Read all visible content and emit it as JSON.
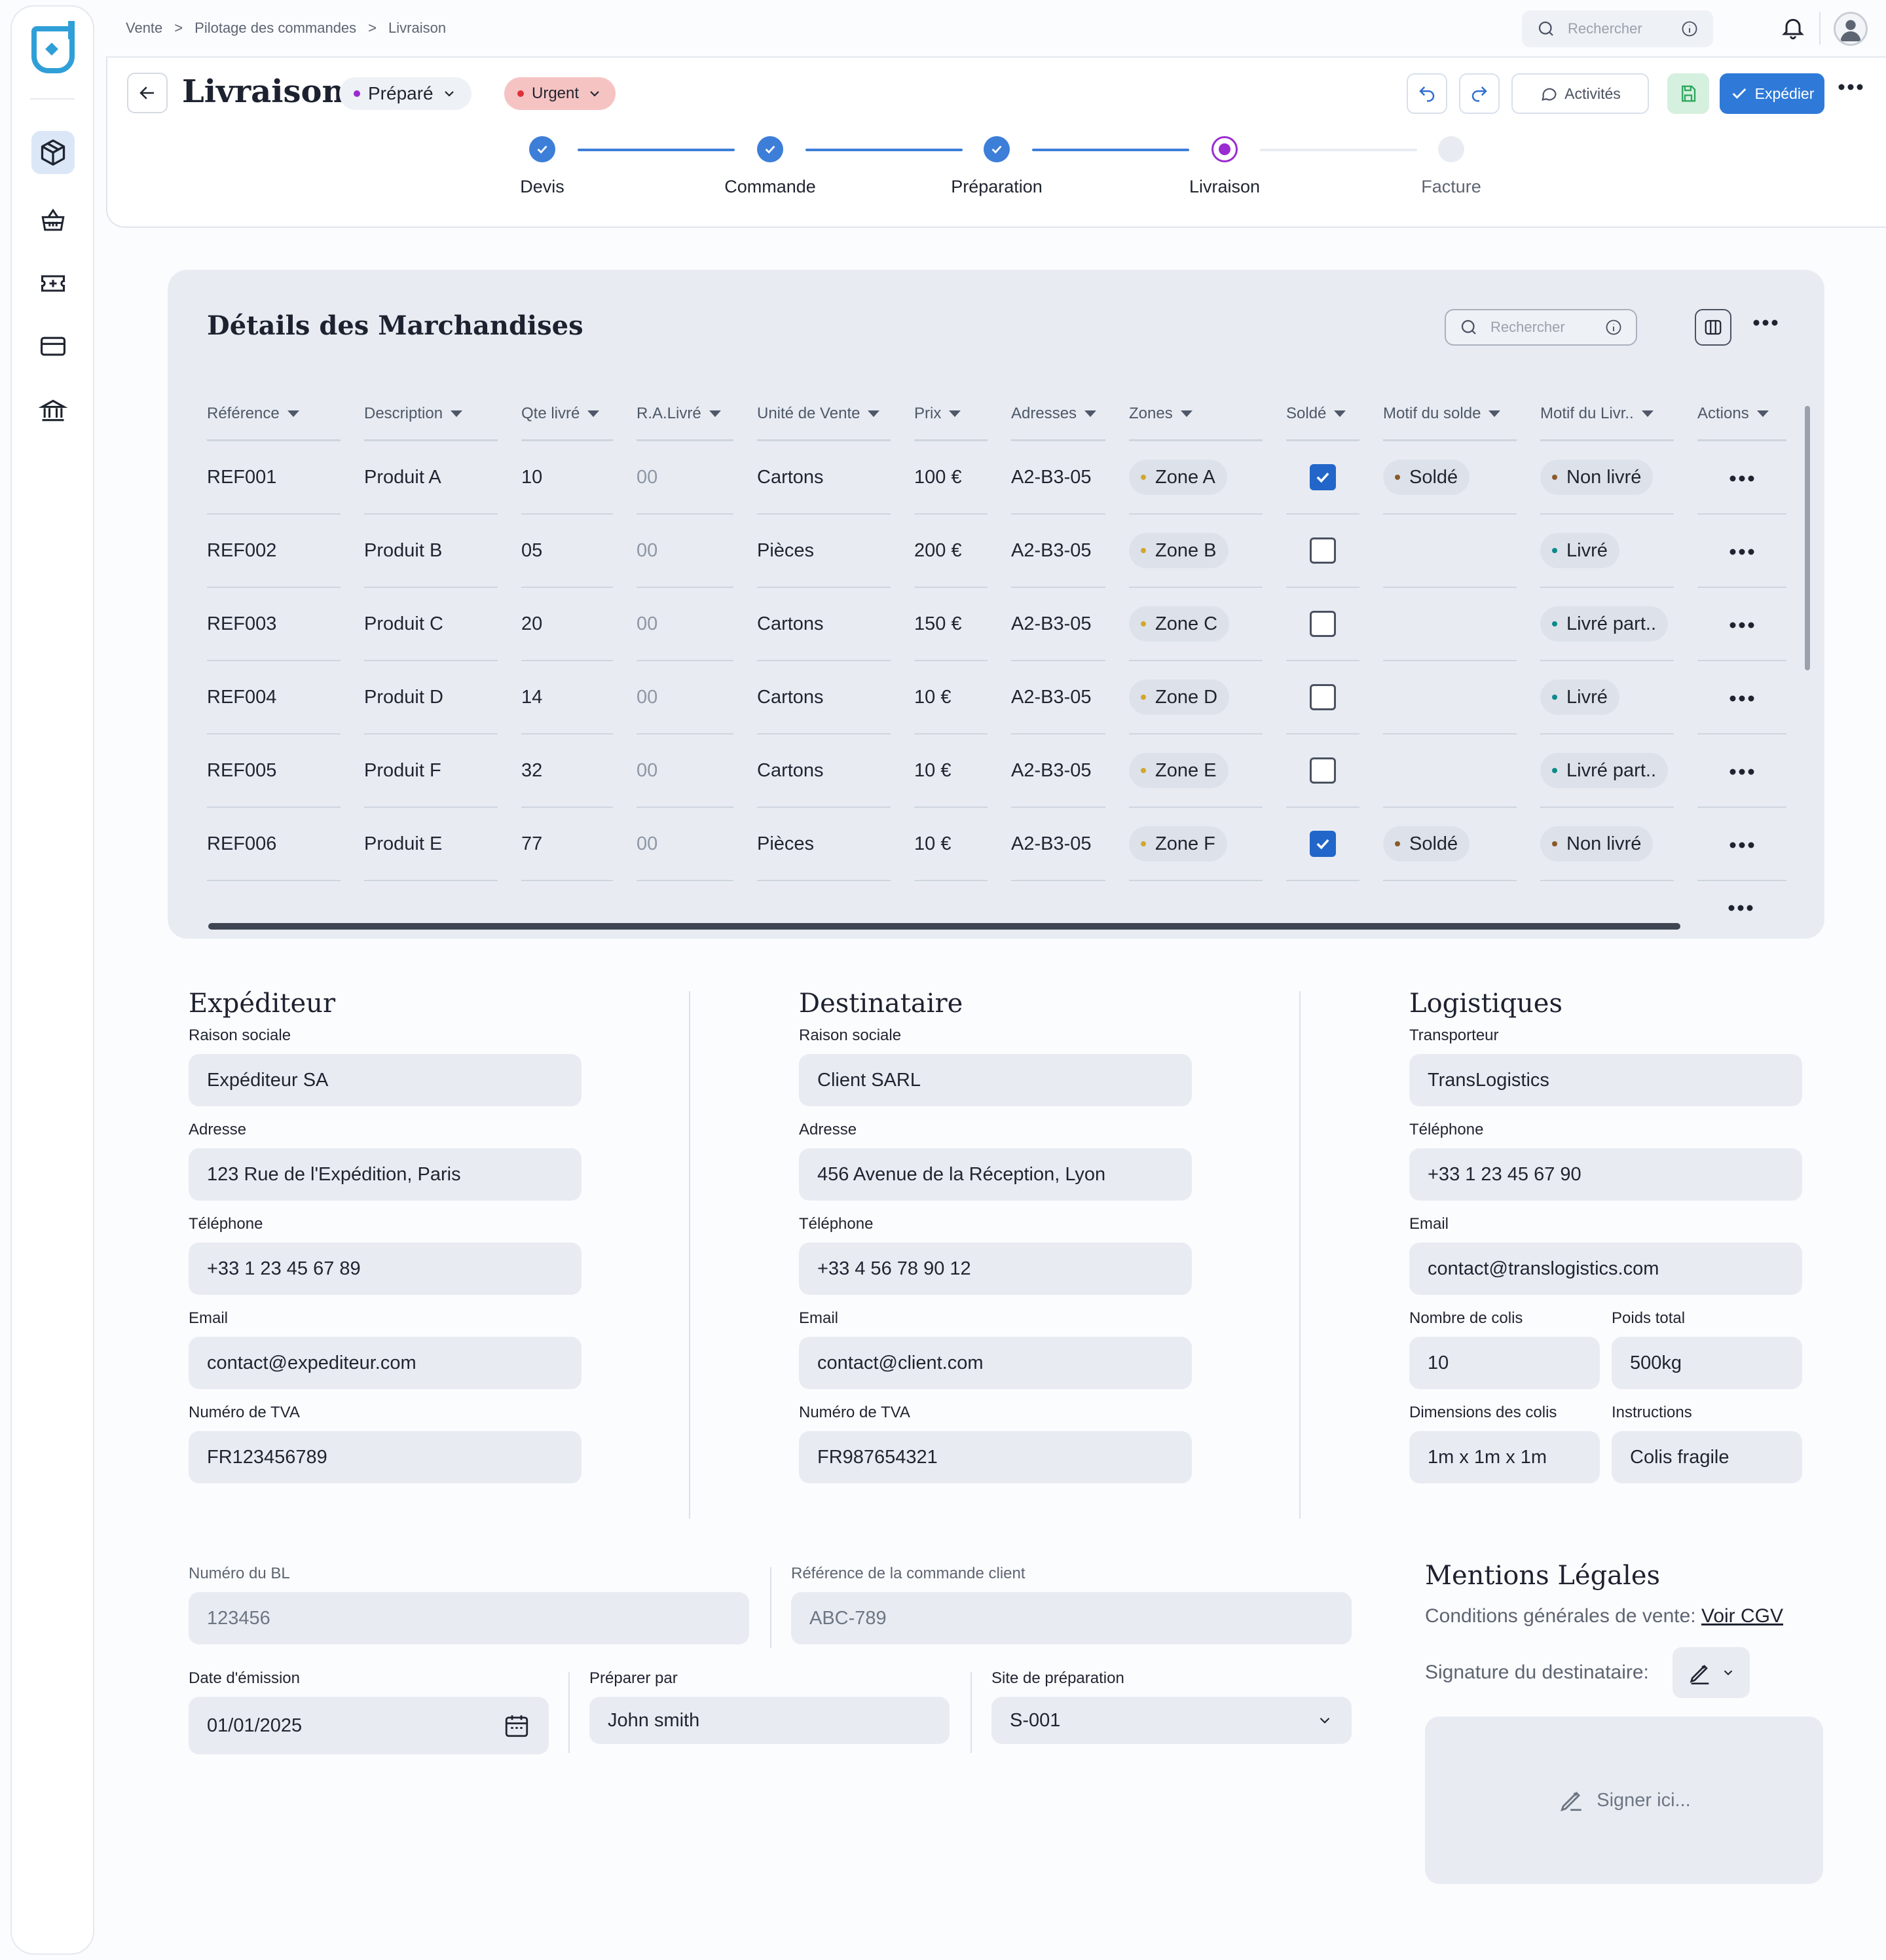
{
  "breadcrumb": [
    "Vente",
    "Pilotage des commandes",
    "Livraison"
  ],
  "breadcrumb_sep": ">",
  "topbar": {
    "search_placeholder": "Rechercher"
  },
  "header": {
    "title": "Livraison",
    "status": "Préparé",
    "priority": "Urgent",
    "activities_label": "Activités",
    "ship_label": "Expédier"
  },
  "steps": [
    {
      "label": "Devis",
      "state": "done"
    },
    {
      "label": "Commande",
      "state": "done"
    },
    {
      "label": "Préparation",
      "state": "done"
    },
    {
      "label": "Livraison",
      "state": "current"
    },
    {
      "label": "Facture",
      "state": "todo"
    }
  ],
  "goods": {
    "title": "Détails des Marchandises",
    "search_placeholder": "Rechercher",
    "columns": [
      "Référence",
      "Description",
      "Qte livré",
      "R.A.Livré",
      "Unité de Vente",
      "Prix",
      "Adresses",
      "Zones",
      "Soldé",
      "Motif du solde",
      "Motif du Livr..",
      "Actions"
    ],
    "rows": [
      {
        "ref": "REF001",
        "desc": "Produit A",
        "qty": "10",
        "ra": "00",
        "unit": "Cartons",
        "price": "100 €",
        "addr": "A2-B3-05",
        "zone": "Zone A",
        "solde": true,
        "motif": "Soldé",
        "livr": "Non livré",
        "livr_color": "#8a5a2b"
      },
      {
        "ref": "REF002",
        "desc": "Produit B",
        "qty": "05",
        "ra": "00",
        "unit": "Pièces",
        "price": "200 €",
        "addr": "A2-B3-05",
        "zone": "Zone B",
        "solde": false,
        "motif": "",
        "livr": "Livré",
        "livr_color": "#0f8a8a"
      },
      {
        "ref": "REF003",
        "desc": "Produit C",
        "qty": "20",
        "ra": "00",
        "unit": "Cartons",
        "price": "150 €",
        "addr": "A2-B3-05",
        "zone": "Zone C",
        "solde": false,
        "motif": "",
        "livr": "Livré part..",
        "livr_color": "#0f8a8a"
      },
      {
        "ref": "REF004",
        "desc": "Produit D",
        "qty": "14",
        "ra": "00",
        "unit": "Cartons",
        "price": "10 €",
        "addr": "A2-B3-05",
        "zone": "Zone D",
        "solde": false,
        "motif": "",
        "livr": "Livré",
        "livr_color": "#0f8a8a"
      },
      {
        "ref": "REF005",
        "desc": "Produit F",
        "qty": "32",
        "ra": "00",
        "unit": "Cartons",
        "price": "10 €",
        "addr": "A2-B3-05",
        "zone": "Zone E",
        "solde": false,
        "motif": "",
        "livr": "Livré part..",
        "livr_color": "#0f8a8a"
      },
      {
        "ref": "REF006",
        "desc": "Produit E",
        "qty": "77",
        "ra": "00",
        "unit": "Pièces",
        "price": "10 €",
        "addr": "A2-B3-05",
        "zone": "Zone F",
        "solde": true,
        "motif": "Soldé",
        "livr": "Non livré",
        "livr_color": "#8a5a2b"
      }
    ]
  },
  "expediteur": {
    "title": "Expéditeur",
    "fields": [
      {
        "label": "Raison sociale",
        "value": "Expéditeur SA"
      },
      {
        "label": "Adresse",
        "value": "123 Rue de l'Expédition, Paris"
      },
      {
        "label": "Téléphone",
        "value": "+33 1 23 45 67 89"
      },
      {
        "label": "Email",
        "value": "contact@expediteur.com"
      },
      {
        "label": "Numéro de TVA",
        "value": "FR123456789"
      }
    ]
  },
  "destinataire": {
    "title": "Destinataire",
    "fields": [
      {
        "label": "Raison sociale",
        "value": "Client SARL"
      },
      {
        "label": "Adresse",
        "value": "456 Avenue de la Réception, Lyon"
      },
      {
        "label": "Téléphone",
        "value": "+33 4 56 78 90 12"
      },
      {
        "label": "Email",
        "value": "contact@client.com"
      },
      {
        "label": "Numéro de TVA",
        "value": "FR987654321"
      }
    ]
  },
  "logistiques": {
    "title": "Logistiques",
    "transporteur_label": "Transporteur",
    "transporteur": "TransLogistics",
    "telephone_label": "Téléphone",
    "telephone": "+33 1 23 45 67 90",
    "email_label": "Email",
    "email": "contact@translogistics.com",
    "colis_label": "Nombre de colis",
    "colis": "10",
    "poids_label": "Poids total",
    "poids": "500kg",
    "dimensions_label": "Dimensions des colis",
    "dimensions": "1m x 1m x 1m",
    "instructions_label": "Instructions",
    "instructions": "Colis fragile"
  },
  "bl": {
    "numero_label": "Numéro du BL",
    "numero": "123456",
    "ref_label": "Référence de la commande client",
    "ref": "ABC-789",
    "date_label": "Date d'émission",
    "date": "01/01/2025",
    "preparer_label": "Préparer par",
    "preparer": "John smith",
    "site_label": "Site de préparation",
    "site": "S-001"
  },
  "mentions": {
    "title": "Mentions Légales",
    "cgv_text": "Conditions générales de vente:",
    "cgv_link": "Voir CGV",
    "signature_label": "Signature du destinataire:",
    "sign_placeholder": "Signer ici..."
  },
  "colors": {
    "accent": "#2266c9",
    "step_done": "#3d7ed8",
    "step_current": "#9b2bd1",
    "urgent_bg": "#f6c3c3",
    "zone_dot": "#d4a72c"
  }
}
